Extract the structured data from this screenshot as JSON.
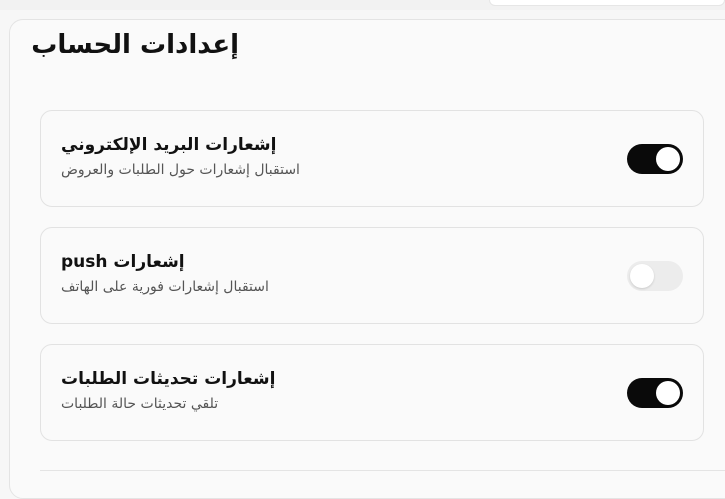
{
  "section": {
    "title": "إعدادات الحساب"
  },
  "settings": [
    {
      "title": "إشعارات البريد الإلكتروني",
      "description": "استقبال إشعارات حول الطلبات والعروض",
      "enabled": true
    },
    {
      "title": "إشعارات push",
      "description": "استقبال إشعارات فورية على الهاتف",
      "enabled": false
    },
    {
      "title": "إشعارات تحديثات الطلبات",
      "description": "تلقي تحديثات حالة الطلبات",
      "enabled": true
    }
  ],
  "colors": {
    "toggle_on": "#0a0a0a",
    "toggle_off": "#ececec"
  }
}
